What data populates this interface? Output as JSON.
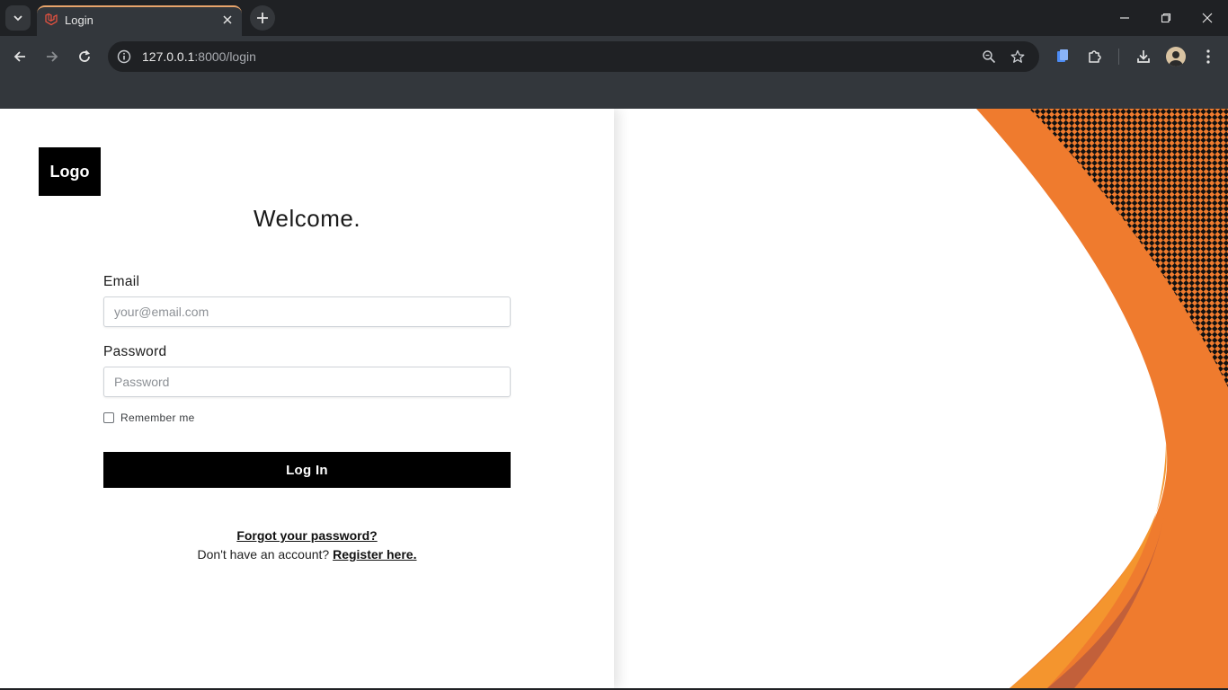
{
  "browser": {
    "tab": {
      "title": "Login"
    },
    "address": {
      "host": "127.0.0.1",
      "path": ":8000/login"
    }
  },
  "page": {
    "logo_text": "Logo",
    "welcome": "Welcome.",
    "email": {
      "label": "Email",
      "placeholder": "your@email.com"
    },
    "password": {
      "label": "Password",
      "placeholder": "Password"
    },
    "remember_label": "Remember me",
    "login_button": "Log In",
    "forgot_link": "Forgot your password?",
    "register_prompt": "Don't have an account?",
    "register_link": "Register here."
  },
  "colors": {
    "accent": "#ef7b2e",
    "accent_light": "#f4952e",
    "accent_dark": "#c2603a",
    "button": "#000000"
  }
}
